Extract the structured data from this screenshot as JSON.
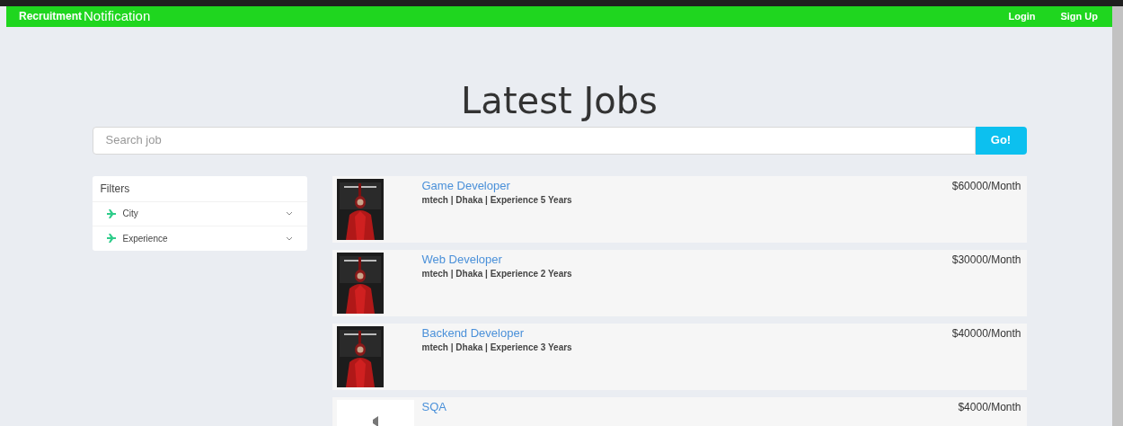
{
  "navbar": {
    "brand_bold": "Recruitment",
    "brand": "Notification",
    "links": [
      "Login",
      "Sign Up"
    ]
  },
  "heading": "Latest Jobs",
  "search": {
    "placeholder": "Search job",
    "button": "Go!"
  },
  "filters": {
    "title": "Filters",
    "items": [
      {
        "label": "City",
        "expanded": false
      },
      {
        "label": "Experience",
        "expanded": false
      }
    ]
  },
  "jobs": [
    {
      "title": "Game Developer",
      "details": "mtech | Dhaka | Experience 5 Years",
      "salary": "$60000/Month"
    },
    {
      "title": "Web Developer",
      "details": "mtech | Dhaka | Experience 2 Years",
      "salary": "$30000/Month"
    },
    {
      "title": "Backend Developer",
      "details": "mtech | Dhaka | Experience 3 Years",
      "salary": "$40000/Month"
    },
    {
      "title": "SQA",
      "salary": "$4000/Month"
    }
  ]
}
